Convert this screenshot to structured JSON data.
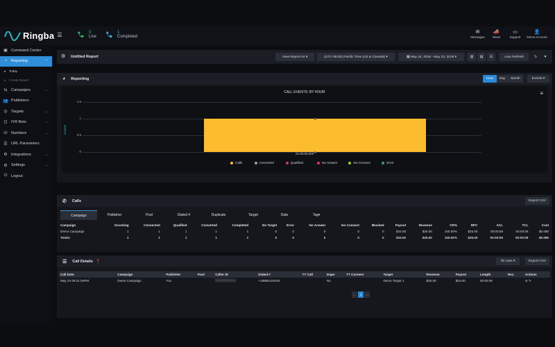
{
  "app": {
    "name": "Ringba",
    "live_count": "0",
    "live_label": "Live",
    "completed_count": "1",
    "completed_label": "Completed"
  },
  "top_icons": [
    {
      "icon": "messages-icon",
      "label": "Messages"
    },
    {
      "icon": "news-icon",
      "label": "News"
    },
    {
      "icon": "support-icon",
      "label": "Support"
    },
    {
      "icon": "account-icon",
      "label": "Demo Account"
    }
  ],
  "sidebar": {
    "items": [
      {
        "label": "Command Center",
        "icon": "command-center-icon"
      },
      {
        "label": "Reporting",
        "icon": "reporting-icon"
      },
      {
        "label": "Campaigns",
        "icon": "campaigns-icon"
      },
      {
        "label": "Publishers",
        "icon": "publishers-icon"
      },
      {
        "label": "Targets",
        "icon": "targets-icon"
      },
      {
        "label": "IVR Bots",
        "icon": "ivr-icon"
      },
      {
        "label": "Numbers",
        "icon": "numbers-icon"
      },
      {
        "label": "URL Parameters",
        "icon": "url-icon"
      },
      {
        "label": "Integrations",
        "icon": "integrations-icon"
      },
      {
        "label": "Settings",
        "icon": "settings-icon"
      },
      {
        "label": "Logout",
        "icon": "logout-icon"
      }
    ],
    "sub": [
      {
        "label": "Today"
      },
      {
        "label": "Create Report"
      }
    ]
  },
  "report_bar": {
    "title": "Untitled Report",
    "view_as": "View Report As",
    "timezone": "(UTC-08:00) Pacific Time (US & Canada)",
    "daterange": "May 24, 2018 - May 24, 2018",
    "auto_refresh": "Auto Refresh"
  },
  "reporting": {
    "title": "Reporting",
    "granularity": [
      "Hour",
      "Day",
      "Month"
    ],
    "events_btn": "Events"
  },
  "chart_data": {
    "type": "bar",
    "title": "CALL EVENTS: BY HOUR",
    "ylabel": "Counts",
    "xlabel": "",
    "categories": [
      "21:00:00.000"
    ],
    "ylim": [
      0,
      1.5
    ],
    "yticks": [
      "1.5",
      "1",
      "0.5",
      "0"
    ],
    "series": [
      {
        "name": "Calls",
        "color": "#fbbd2d",
        "values": [
          1
        ]
      },
      {
        "name": "Converted",
        "color": "#9aa3ad",
        "values": [
          0
        ]
      },
      {
        "name": "Qualified",
        "color": "#c8387a",
        "values": [
          0
        ]
      },
      {
        "name": "No Answer",
        "color": "#e0365a",
        "values": [
          0
        ]
      },
      {
        "name": "No Connect",
        "color": "#9acd32",
        "values": [
          0
        ]
      },
      {
        "name": "Error",
        "color": "#2ea86b",
        "values": [
          0
        ]
      }
    ]
  },
  "calls": {
    "title": "Calls",
    "export": "Export CSV",
    "tabs": [
      "Campaign",
      "Publisher",
      "Pool",
      "Dialed #",
      "Duplicate",
      "Target",
      "Date",
      "Tag"
    ],
    "columns": [
      "Campaign",
      "Incoming",
      "Connected",
      "Qualified",
      "Converted",
      "Completed",
      "No Target",
      "Error",
      "No Answer",
      "No Connect",
      "Blocked",
      "Payout",
      "Revenue",
      "CR%",
      "RPC",
      "ACL",
      "TCL",
      "Cost"
    ],
    "rows": [
      [
        "Demo Campaign",
        "1",
        "1",
        "1",
        "1",
        "1",
        "0",
        "0",
        "0",
        "0",
        "0",
        "$15.00",
        "$25.00",
        "100.00%",
        "$25.00",
        "00:00:09",
        "00:00:09",
        "$0.085"
      ]
    ],
    "totals": [
      "Totals:",
      "1",
      "1",
      "1",
      "1",
      "1",
      "0",
      "0",
      "0",
      "0",
      "0",
      "$15.00",
      "$25.00",
      "100.00%",
      "$25.00",
      "00:00:09",
      "00:00:09",
      "$0.085"
    ]
  },
  "details": {
    "title": "Call Details",
    "rows_select": "25 rows",
    "export": "Export CSV",
    "columns": [
      "Call Date",
      "Campaign",
      "Publisher",
      "Pool",
      "Caller ID",
      "Dialed #",
      "TT Call",
      "Dupe",
      "TT Connect",
      "Target",
      "Revenue",
      "Payout",
      "Length",
      "Rec.",
      "Actions"
    ],
    "rows": [
      [
        "May 24 09:21:54PM",
        "Demo Campaign",
        "You",
        "",
        "",
        "+18886120418",
        "",
        "No",
        "",
        "Demo Target 1",
        "$25.00",
        "$15.00",
        "00:00:09",
        "",
        ""
      ]
    ],
    "pager": [
      "...",
      "1",
      "..."
    ]
  }
}
